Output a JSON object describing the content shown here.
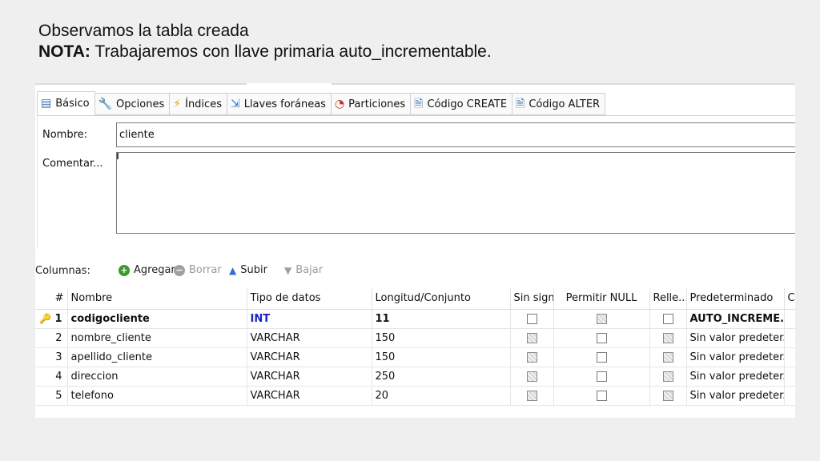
{
  "slide": {
    "line1": "Observamos la tabla creada",
    "line2_bold": "NOTA:",
    "line2_rest": " Trabajaremos con llave primaria auto_incrementable."
  },
  "tabs": [
    {
      "label": "Básico",
      "icon": "table-icon",
      "active": true
    },
    {
      "label": "Opciones",
      "icon": "wrench-icon"
    },
    {
      "label": "Índices",
      "icon": "lightning-icon"
    },
    {
      "label": "Llaves foráneas",
      "icon": "foreign-key-icon"
    },
    {
      "label": "Particiones",
      "icon": "pie-chart-icon"
    },
    {
      "label": "Código CREATE",
      "icon": "sql-icon"
    },
    {
      "label": "Código ALTER",
      "icon": "sql-icon"
    }
  ],
  "form": {
    "name_label": "Nombre:",
    "name_value": "cliente",
    "comment_label": "Comentar..."
  },
  "columns_bar": {
    "title": "Columnas:",
    "add": "Agregar",
    "delete": "Borrar",
    "up": "Subir",
    "down": "Bajar"
  },
  "table": {
    "headers": [
      "#",
      "Nombre",
      "Tipo de datos",
      "Longitud/Conjunto",
      "Sin signo",
      "Permitir NULL",
      "Relle...",
      "Predeterminado",
      "C"
    ],
    "rows": [
      {
        "num": "1",
        "name": "codigocliente",
        "type": "INT",
        "length": "11",
        "unsigned": false,
        "allow_null": false,
        "zerofill": false,
        "default": "AUTO_INCREME...",
        "primary": true
      },
      {
        "num": "2",
        "name": "nombre_cliente",
        "type": "VARCHAR",
        "length": "150",
        "unsigned": false,
        "allow_null": false,
        "zerofill": false,
        "default": "Sin valor predeter..."
      },
      {
        "num": "3",
        "name": "apellido_cliente",
        "type": "VARCHAR",
        "length": "150",
        "unsigned": false,
        "allow_null": false,
        "zerofill": false,
        "default": "Sin valor predeter..."
      },
      {
        "num": "4",
        "name": "direccion",
        "type": "VARCHAR",
        "length": "250",
        "unsigned": false,
        "allow_null": false,
        "zerofill": false,
        "default": "Sin valor predeter..."
      },
      {
        "num": "5",
        "name": "telefono",
        "type": "VARCHAR",
        "length": "20",
        "unsigned": false,
        "allow_null": false,
        "zerofill": false,
        "default": "Sin valor predeter..."
      }
    ]
  },
  "colors": {
    "int_type": "#1a22c8",
    "varchar_type": "#2e8b1e",
    "default_placeholder": "#8f8f8f",
    "add_icon": "#3a9a2a",
    "up_arrow": "#2e6fd0"
  }
}
